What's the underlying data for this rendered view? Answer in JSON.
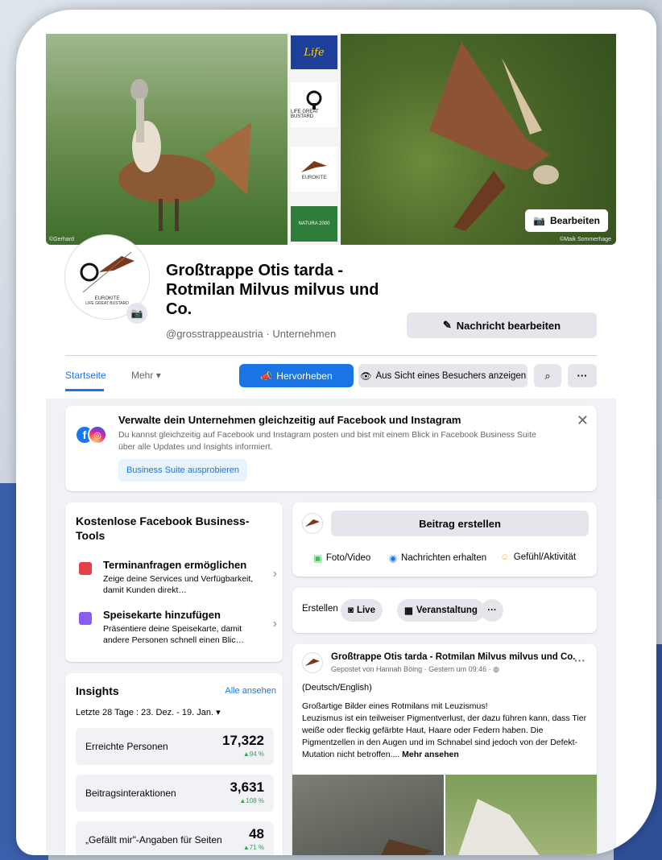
{
  "cover": {
    "eu_label": "Life",
    "lgb_label": "LIFE GREAT BUSTARD",
    "eurokite_label": "EUROKITE",
    "natura_label": "NATURA 2000",
    "credit_left": "©Gerhard",
    "credit_right": "©Maik Sommerhage",
    "edit_button": "Bearbeiten"
  },
  "profile": {
    "avatar_text": "EUROKITE",
    "avatar_sub": "LIFE GREAT BUSTARD",
    "name": "Großtrappe Otis tarda - Rotmilan Milvus milvus und Co.",
    "subtitle": "@grosstrappeaustria · Unternehmen",
    "message_button": "Nachricht bearbeiten"
  },
  "tabs": {
    "start": "Startseite",
    "more": "Mehr",
    "promote": "Hervorheben",
    "visitor_view": "Aus Sicht eines Besuchers anzeigen",
    "more_dots": "···"
  },
  "ig_banner": {
    "title": "Verwalte dein Unternehmen gleichzeitig auf Facebook und Instagram",
    "text": "Du kannst gleichzeitig auf Facebook und Instagram posten und bist mit einem Blick in Facebook Business Suite über alle Updates und Insights informiert.",
    "button": "Business Suite ausprobieren"
  },
  "tools": {
    "title": "Kostenlose Facebook Business-Tools",
    "items": [
      {
        "title": "Terminanfragen ermöglichen",
        "desc": "Zeige deine Services und Verfügbarkeit, damit Kunden direkt…"
      },
      {
        "title": "Speisekarte hinzufügen",
        "desc": "Präsentiere deine Speisekarte, damit andere Personen schnell einen Blic…"
      }
    ]
  },
  "insights": {
    "title": "Insights",
    "see_all": "Alle ansehen",
    "range_label": "Letzte 28 Tage :",
    "range_value": "23. Dez. - 19. Jan.",
    "cards": [
      {
        "label": "Erreichte Personen",
        "value": "17,322",
        "change": "▲94 %"
      },
      {
        "label": "Beitragsinteraktionen",
        "value": "3,631",
        "change": "▲108 %"
      },
      {
        "label": "„Gefällt mir\"-Angaben für Seiten",
        "value": "48",
        "change": "▲71 %"
      }
    ]
  },
  "composer": {
    "create_post": "Beitrag erstellen",
    "photo": "Foto/Video",
    "messages": "Nachrichten erhalten",
    "feeling": "Gefühl/Aktivität",
    "create_label": "Erstellen",
    "live": "Live",
    "event": "Veranstaltung",
    "dots": "···"
  },
  "post": {
    "author": "Großtrappe Otis tarda - Rotmilan Milvus milvus und Co.",
    "meta": "Gepostet von Hannah Böing · Gestern um 09:46 ·",
    "lang": "(Deutsch/English)",
    "line1": "Großartige Bilder eines Rotmilans mit Leuzismus!",
    "body": "Leuzismus ist ein teilweiser Pigmentverlust, der dazu führen kann, dass Tier weiße oder fleckig gefärbte Haut, Haare oder Federn haben. Die Pigmentzellen in den Augen und im Schnabel sind jedoch von der Defekt-Mutation nicht betroffen.... ",
    "see_more": "Mehr ansehen",
    "more_dots": "···"
  },
  "colors": {
    "accent": "#1b74e4",
    "positive": "#31a24c",
    "background": "#f0f2f5"
  }
}
